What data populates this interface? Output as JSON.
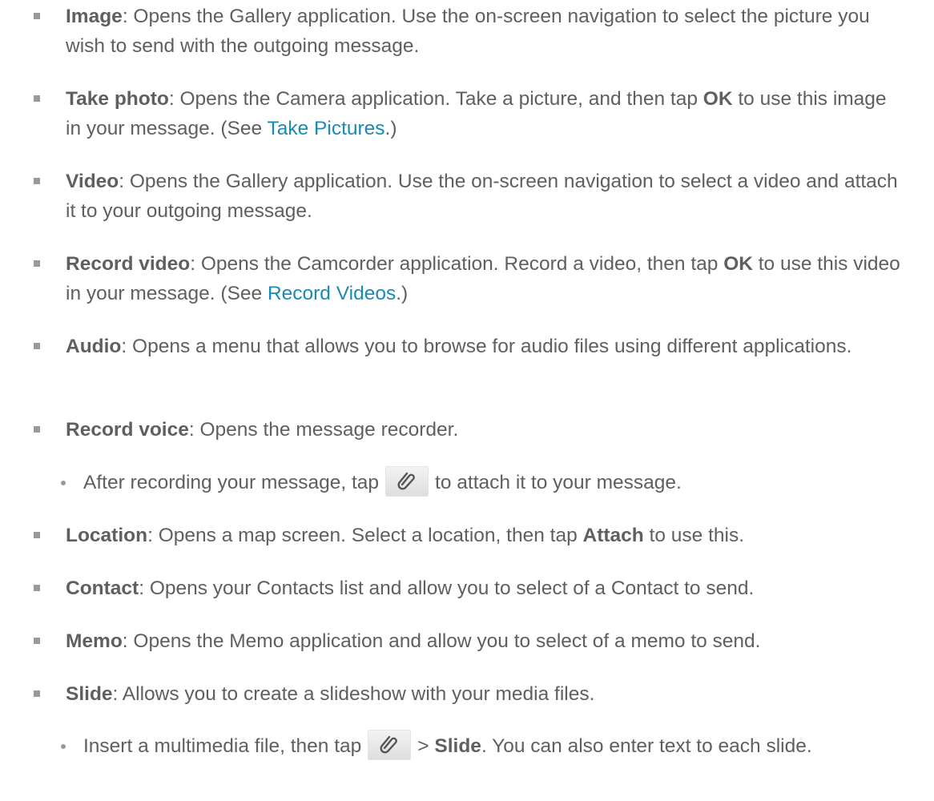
{
  "items": [
    {
      "term": "Image",
      "text": ": Opens the Gallery application. Use the on-screen navigation to select the picture you wish to send with the outgoing message."
    },
    {
      "term": "Take photo",
      "text_a": ": Opens the Camera application. Take a picture, and then tap ",
      "strong": "OK",
      "text_b": " to use this image in your message. (See ",
      "link": "Take Pictures",
      "text_c": ".)"
    },
    {
      "term": "Video",
      "text": ": Opens the Gallery application. Use the on-screen navigation to select a video and attach it to your outgoing message."
    },
    {
      "term": "Record video",
      "text_a": ": Opens the Camcorder application. Record a video, then tap ",
      "strong": "OK",
      "text_b": " to use this video in your message. (See ",
      "link": "Record Videos",
      "text_c": ".)"
    },
    {
      "term": "Audio",
      "text": ": Opens a menu that allows you to browse for audio files using different applications."
    },
    {
      "term": "Record voice",
      "text": ": Opens the message recorder."
    },
    {
      "sub_a": "After recording your message, tap",
      "sub_b": "to attach it to your message."
    },
    {
      "term": "Location",
      "text_a": ": Opens a map screen. Select a location, then tap ",
      "strong": "Attach",
      "text_b": " to use this."
    },
    {
      "term": "Contact",
      "text": ": Opens your Contacts list and allow you to select of a Contact to send."
    },
    {
      "term": "Memo",
      "text": ": Opens the Memo application and allow you to select of a memo to send."
    },
    {
      "term": "Slide",
      "text": ": Allows you to create a slideshow with your media files."
    },
    {
      "sub_a": "Insert a multimedia file, then tap",
      "sep": ">",
      "strong": "Slide",
      "sub_b": ". You can also enter text to each slide."
    }
  ],
  "icons": {
    "attach": "paperclip-icon"
  }
}
